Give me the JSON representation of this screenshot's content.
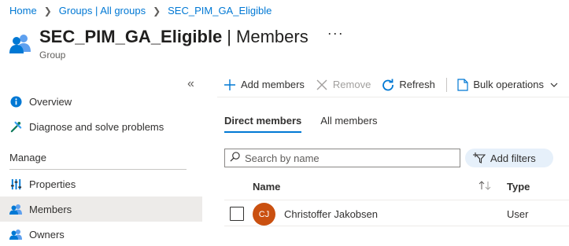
{
  "breadcrumb": [
    "Home",
    "Groups | All groups",
    "SEC_PIM_GA_Eligible"
  ],
  "header": {
    "title": "SEC_PIM_GA_Eligible",
    "section": "Members",
    "more": "···",
    "subtitle": "Group"
  },
  "sidebar": {
    "collapse": "«",
    "items": [
      {
        "label": "Overview",
        "icon": "info-icon"
      },
      {
        "label": "Diagnose and solve problems",
        "icon": "wrench-icon"
      }
    ],
    "section_label": "Manage",
    "manage_items": [
      {
        "label": "Properties",
        "icon": "sliders-icon"
      },
      {
        "label": "Members",
        "icon": "people-icon",
        "active": true
      },
      {
        "label": "Owners",
        "icon": "people-icon"
      }
    ]
  },
  "toolbar": {
    "add": "Add members",
    "remove": "Remove",
    "refresh": "Refresh",
    "bulk": "Bulk operations"
  },
  "tabs": {
    "direct": "Direct members",
    "all": "All members"
  },
  "search": {
    "placeholder": "Search by name"
  },
  "filter": {
    "label": "Add filters"
  },
  "table": {
    "columns": {
      "name": "Name",
      "type": "Type"
    },
    "rows": [
      {
        "initials": "CJ",
        "name": "Christoffer Jakobsen",
        "type": "User"
      }
    ]
  },
  "colors": {
    "accent": "#0078d4",
    "avatar": "#ca5010",
    "active_bg": "#edebe9"
  }
}
